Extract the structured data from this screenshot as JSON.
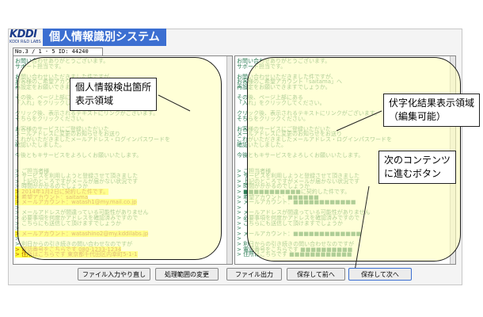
{
  "app": {
    "logo_main": "KDDI",
    "logo_sub": "KDDI R&D LABS",
    "title": "個人情報識別システム"
  },
  "doc_id": "No.3 / 1 - 5 ID: 44240",
  "left_pane": {
    "lines": [
      "お問い合わせありがとうございます。",
      "サポート担当です。",
      "",
      "お問い合わせいただきました件ですが、",
      "お客様のご希望アカウント「saitama」へ",
      "再設定をお願いできますでしょうか。",
      "",
      "その後、ページ上部にある",
      "「入れ」をクリックしてください。",
      "",
      "クリック後、表示されるテキストにリンクがございます。",
      "そちらをクリックください。",
      "",
      "お客様のサービスにご登録いただいた",
      "メールアドレスに変更のお知らせをお送り",
      "これがいただきましたメールアドレス・ログインパスワードを",
      "確認いたしました。",
      "",
      "今後ともキサービスをよろしくお願いいたします。",
      "",
      "",
      "> ご担当者様",
      "> サービスを利用しようと登録させて頂きました",
      "> 上記のところですがメールが届かない状況です",
      "> 時間がかかるのでしょうか",
      "> 2014年1月2日に契約した件です。",
      "> 希望アカウント：saitama",
      "> メールアカウント：watash1@my.mail.co.jp",
      "> ",
      "> メールアドレスが間違っている可能性がありません",
      "> 必要事項を何度かアドレスを確認済みですので",
      "> こちらにも送信して頂けますでしょうか",
      "> ",
      "> メールアカウント：watashino2@my.kddilabs.jp",
      "> ",
      "> 利日からの引き続きの問い合わせなのですが",
      "> 電話番号をこちらです 080-1233-1234",
      "> 住所はこちらです 東京都千代田区内幸町5-1-1"
    ]
  },
  "right_pane": {
    "lines": [
      "お問い合わせありがとうございます。",
      "サポート担当です。",
      "",
      "お問い合わせいただきました件ですが、",
      "お客様のご希望アカウント「saitama」へ",
      "再設定をお願いできますでしょうか。",
      "",
      "その後、ページ上部にある",
      "「入れ」をクリックしてください。",
      "",
      "クリック後、表示されるテキストにリンクがございます。",
      "そちらをクリックください。",
      "",
      "お客様のサービスにご登録いただいた",
      "メールアドレスに変更のお知らせをお送り",
      "これがいただきましたメールアドレス・ログインパスワードを",
      "確認いたしました。",
      "",
      "今後ともキサービスをよろしくお願いいたします。",
      "",
      "",
      "> ご担当者様",
      "> サービスを利用しようと登録させて頂きました",
      "> 上記のところですがメールが届かない状況です",
      "> 時間がかかるのでしょうか",
      "> ■■■■■■■■■■■に契約した件です。",
      "> 希望アカウント：■■■■■■",
      "> メールアカウント：■■■■■■■■■■■■",
      "> ",
      "> メールアドレスが間違っている可能性がありません",
      "> 必要事項を何度かアドレスを確認済みですので",
      "> こちらにも送信して頂けますでしょうか",
      "> ",
      "> メールアカウント：■■■■■■■■■■■■■",
      "> ",
      "> 利日からの引き続きの問い合わせなのですが",
      "> 電話番号をこちらです ■■■■■■■■■■",
      "> 住所はこちらです ■■■■■■■■■■■■"
    ]
  },
  "callouts": {
    "left": "個人情報検出箇所\n表示領域",
    "right": "伏字化結果表示領域\n（編集可能）",
    "next": "次のコンテンツ\nに進むボタン"
  },
  "buttons": {
    "file_input": "ファイル入力やり直し",
    "change_range": "処理範囲の変更",
    "file_output": "ファイル出力",
    "save_prev": "保存して前へ",
    "save_next": "保存して次へ"
  },
  "colors": {
    "title_bg": "#3c6fd1",
    "text_green": "#2d7d55",
    "highlight": "#ffff3c",
    "overlay": "#ffffbe"
  }
}
